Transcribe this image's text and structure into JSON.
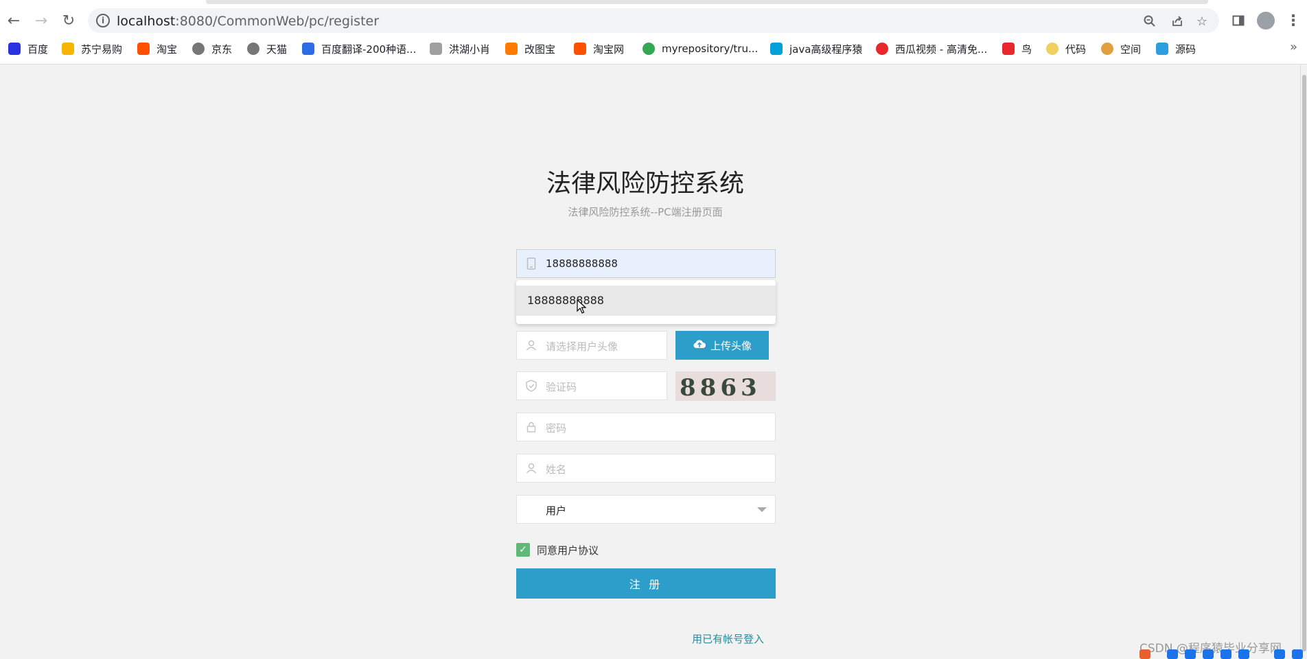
{
  "browser": {
    "url_host": "localhost",
    "url_rest": ":8080/CommonWeb/pc/register"
  },
  "bookmarks": [
    {
      "label": "百度",
      "color": "#2932e1"
    },
    {
      "label": "苏宁易购",
      "color": "#f7b500"
    },
    {
      "label": "淘宝",
      "color": "#ff5000"
    },
    {
      "label": "京东",
      "color": "#777777"
    },
    {
      "label": "天猫",
      "color": "#777777"
    },
    {
      "label": "百度翻译-200种语...",
      "color": "#2b6de5"
    },
    {
      "label": "洪湖小肖",
      "color": "#a0a0a0"
    },
    {
      "label": "改图宝",
      "color": "#ff7a00"
    },
    {
      "label": "淘宝网",
      "color": "#ff5000"
    },
    {
      "label": "myrepository/tru...",
      "color": "#34a853"
    },
    {
      "label": "java高级程序猿",
      "color": "#00a1d6"
    },
    {
      "label": "西瓜视频 - 高清免...",
      "color": "#e8282b"
    },
    {
      "label": "鸟",
      "color": "#e8282b"
    },
    {
      "label": "代码",
      "color": "#f0d060"
    },
    {
      "label": "空间",
      "color": "#e0a040"
    },
    {
      "label": "源码",
      "color": "#2d9ee0"
    }
  ],
  "page": {
    "title": "法律风险防控系统",
    "subtitle": "法律风险防控系统--PC端注册页面"
  },
  "form": {
    "phone_value": "18888888888",
    "autocomplete_option": "18888888888",
    "avatar_placeholder": "请选择用户头像",
    "upload_label": "上传头像",
    "captcha_placeholder": "验证码",
    "captcha_text": "8863",
    "password_placeholder": "密码",
    "name_placeholder": "姓名",
    "role_selected": "用户",
    "agree_label": "同意用户协议",
    "agree_checked": true,
    "submit_label": "注 册",
    "login_link": "用已有帐号登入"
  },
  "watermark": "CSDN @程序猿毕业分享网"
}
